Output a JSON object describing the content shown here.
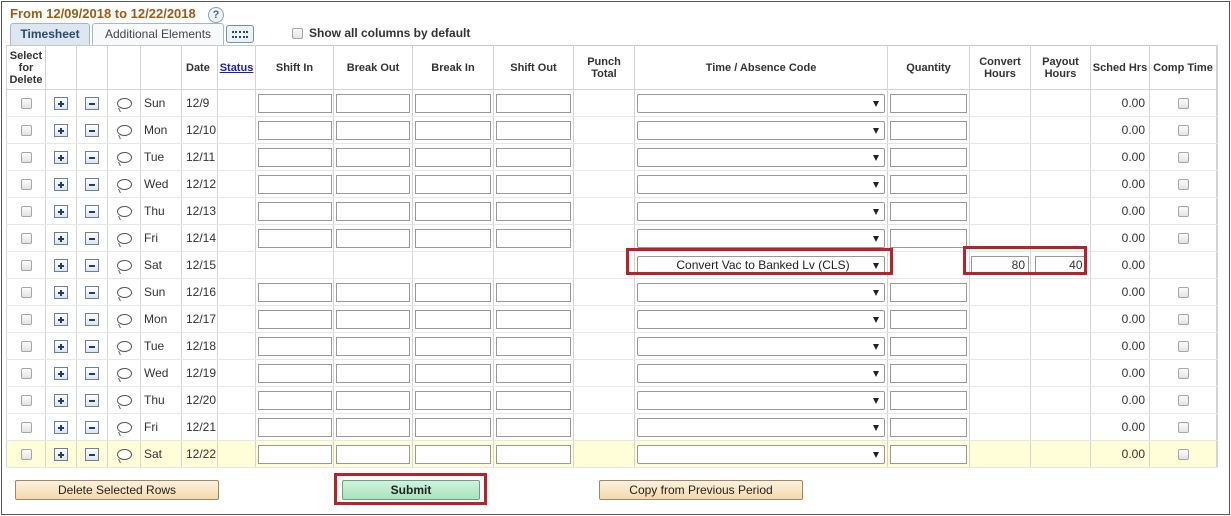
{
  "header": {
    "period": "From 12/09/2018 to 12/22/2018",
    "help_icon": "?",
    "show_all_label": "Show all columns by default"
  },
  "tabs": {
    "timesheet": "Timesheet",
    "additional": "Additional Elements",
    "grid_view_icon": "grid-icon"
  },
  "columns": {
    "select_delete": "Select for Delete",
    "date": "Date",
    "status": "Status",
    "shift_in": "Shift In",
    "break_out": "Break Out",
    "break_in": "Break In",
    "shift_out": "Shift Out",
    "punch_total": "Punch Total",
    "code": "Time / Absence Code",
    "quantity": "Quantity",
    "convert_hours": "Convert Hours",
    "payout_hours": "Payout Hours",
    "sched_hrs": "Sched Hrs",
    "comp_time": "Comp Time"
  },
  "rows": [
    {
      "day": "Sun",
      "date": "12/9",
      "sched": "0.00"
    },
    {
      "day": "Mon",
      "date": "12/10",
      "sched": "0.00"
    },
    {
      "day": "Tue",
      "date": "12/11",
      "sched": "0.00"
    },
    {
      "day": "Wed",
      "date": "12/12",
      "sched": "0.00"
    },
    {
      "day": "Thu",
      "date": "12/13",
      "sched": "0.00"
    },
    {
      "day": "Fri",
      "date": "12/14",
      "sched": "0.00"
    },
    {
      "day": "Sat",
      "date": "12/15",
      "sched": "0.00",
      "code": "Convert Vac to Banked Lv (CLS)",
      "convert": "80",
      "payout": "40"
    },
    {
      "day": "Sun",
      "date": "12/16",
      "sched": "0.00"
    },
    {
      "day": "Mon",
      "date": "12/17",
      "sched": "0.00"
    },
    {
      "day": "Tue",
      "date": "12/18",
      "sched": "0.00"
    },
    {
      "day": "Wed",
      "date": "12/19",
      "sched": "0.00"
    },
    {
      "day": "Thu",
      "date": "12/20",
      "sched": "0.00"
    },
    {
      "day": "Fri",
      "date": "12/21",
      "sched": "0.00"
    },
    {
      "day": "Sat",
      "date": "12/22",
      "sched": "0.00"
    }
  ],
  "buttons": {
    "delete": "Delete Selected Rows",
    "submit": "Submit",
    "copy": "Copy from Previous Period"
  },
  "colors": {
    "period_text": "#a05a16",
    "highlight": "#b8222a",
    "selected_row": "#fffed9"
  }
}
